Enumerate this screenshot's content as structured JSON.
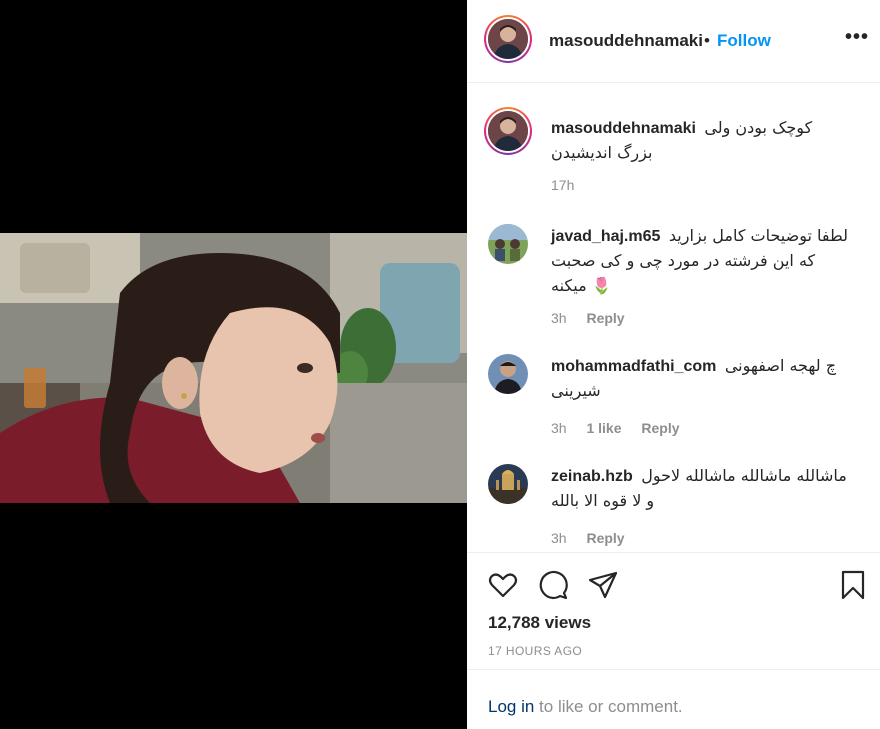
{
  "post": {
    "username": "masouddehnamaki",
    "dot": "•",
    "follow_label": "Follow",
    "more_label": "•••"
  },
  "caption": {
    "username": "masouddehnamaki",
    "text": "کوچک بودن ولی بزرگ اندیشیدن",
    "time": "17h"
  },
  "comments": [
    {
      "username": "javad_haj.m65",
      "text": "لطفا توضیحات کامل بزارید که این فرشته در مورد چی و کی صحبت میکنه 🌷",
      "time": "3h",
      "likes": "",
      "reply_label": "Reply"
    },
    {
      "username": "mohammadfathi_com",
      "text": "چ لهجه اصفهونی شیرینی",
      "time": "3h",
      "likes": "1 like",
      "reply_label": "Reply"
    },
    {
      "username": "zeinab.hzb",
      "text": "ماشالله ماشالله ماشالله لاحول و لا قوه الا بالله",
      "time": "3h",
      "likes": "",
      "reply_label": "Reply"
    }
  ],
  "stats": {
    "views": "12,788 views",
    "timestamp": "17 HOURS AGO"
  },
  "login": {
    "link": "Log in",
    "rest": " to like or comment."
  },
  "icons": {
    "like": "heart-icon",
    "comment": "comment-icon",
    "share": "paper-plane-icon",
    "save": "bookmark-icon",
    "more": "more-options-icon"
  },
  "colors": {
    "accent": "#0095f6",
    "muted": "#8e8e8e",
    "text": "#262626",
    "media_bg": "#000000"
  }
}
